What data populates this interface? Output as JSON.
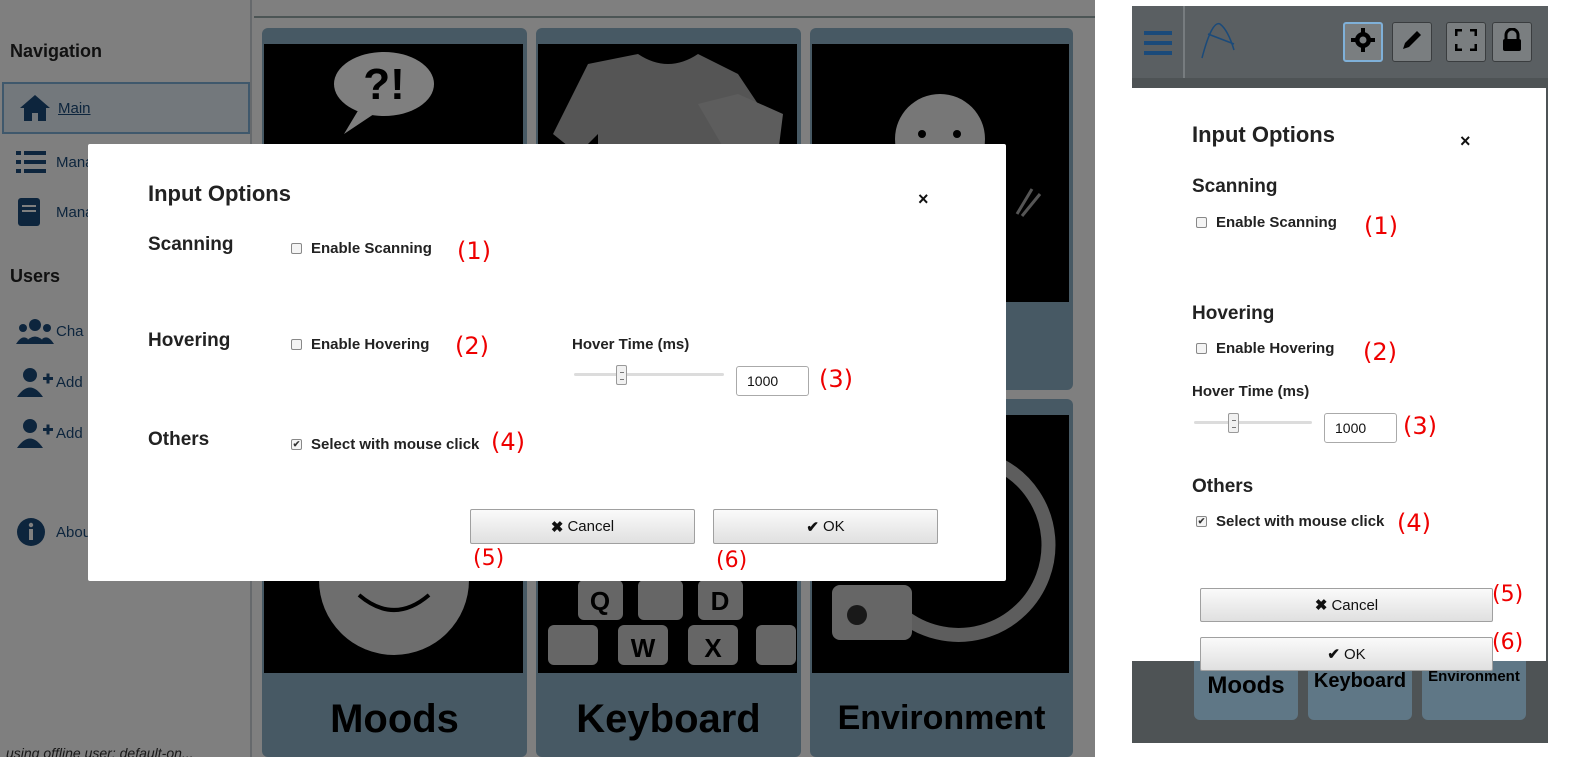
{
  "sidebar": {
    "navigation_heading": "Navigation",
    "items": [
      {
        "label": "Main",
        "icon": "home-icon"
      },
      {
        "label": "Mana",
        "icon": "list-icon"
      },
      {
        "label": "Mana",
        "icon": "book-icon"
      }
    ],
    "users_heading": "Users",
    "user_items": [
      {
        "label": "Cha",
        "icon": "users-icon"
      },
      {
        "label": "Add",
        "icon": "user-plus-icon"
      },
      {
        "label": "Add",
        "icon": "user-plus-icon"
      }
    ],
    "about_label": "Abou",
    "footer_text": "using offline user: default-on..."
  },
  "tiles": [
    {
      "label": "Moods"
    },
    {
      "label": "Keyboard"
    },
    {
      "label": "Environment"
    }
  ],
  "modal": {
    "title": "Input Options",
    "close_symbol": "×",
    "scanning": {
      "heading": "Scanning",
      "checkbox_label": "Enable Scanning",
      "checked": false,
      "marker": "(1)"
    },
    "hovering": {
      "heading": "Hovering",
      "checkbox_label": "Enable Hovering",
      "checked": false,
      "marker": "(2)"
    },
    "hover_time": {
      "label": "Hover Time (ms)",
      "value": "1000",
      "slider_fraction": 0.32,
      "marker": "(3)"
    },
    "others": {
      "heading": "Others",
      "checkbox_label": "Select with mouse click",
      "checked": true,
      "check_glyph": "✔",
      "marker": "(4)"
    },
    "cancel": {
      "label": "Cancel",
      "icon_glyph": "✖",
      "marker": "(5)"
    },
    "ok": {
      "label": "OK",
      "icon_glyph": "✔",
      "marker": "(6)"
    }
  },
  "mobile": {
    "tiles": [
      {
        "label": "Moods"
      },
      {
        "label": "Keyboard"
      },
      {
        "label": "Environment"
      }
    ]
  },
  "colors": {
    "marker": "#ee0000",
    "tile_bg": "#8fb3c9",
    "overlay": "rgba(0,0,0,0.5)"
  }
}
